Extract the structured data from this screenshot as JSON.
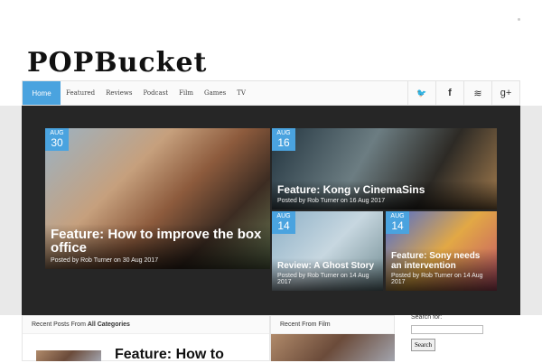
{
  "site": {
    "logo_text": "POPBucket"
  },
  "nav": {
    "home": "Home",
    "items": [
      "Featured",
      "Reviews",
      "Podcast",
      "Film",
      "Games",
      "TV"
    ]
  },
  "social": [
    {
      "icon": "twitter-icon",
      "glyph": "🐦"
    },
    {
      "icon": "facebook-icon",
      "glyph": "f"
    },
    {
      "icon": "rss-icon",
      "glyph": "≋"
    },
    {
      "icon": "googleplus-icon",
      "glyph": "g+"
    }
  ],
  "slider": [
    {
      "month": "AUG",
      "day": "30",
      "title": "Feature: How to improve the box office",
      "byline": "Posted by Rob Turner on 30 Aug 2017"
    },
    {
      "month": "AUG",
      "day": "16",
      "title": "Feature: Kong v CinemaSins",
      "byline": "Posted by Rob Turner on 16 Aug 2017"
    },
    {
      "month": "AUG",
      "day": "14",
      "title": "Review: A Ghost Story",
      "byline": "Posted by Rob Turner on 14 Aug 2017"
    },
    {
      "month": "AUG",
      "day": "14",
      "title": "Feature: Sony needs an intervention",
      "byline": "Posted by Rob Turner on 14 Aug 2017"
    }
  ],
  "recent_all": {
    "prefix": "Recent Posts From ",
    "category": "All Categories",
    "first_title": "Feature: How to"
  },
  "recent_film": {
    "label": "Recent From Film"
  },
  "search": {
    "label": "Search for:",
    "button": "Search",
    "value": ""
  }
}
